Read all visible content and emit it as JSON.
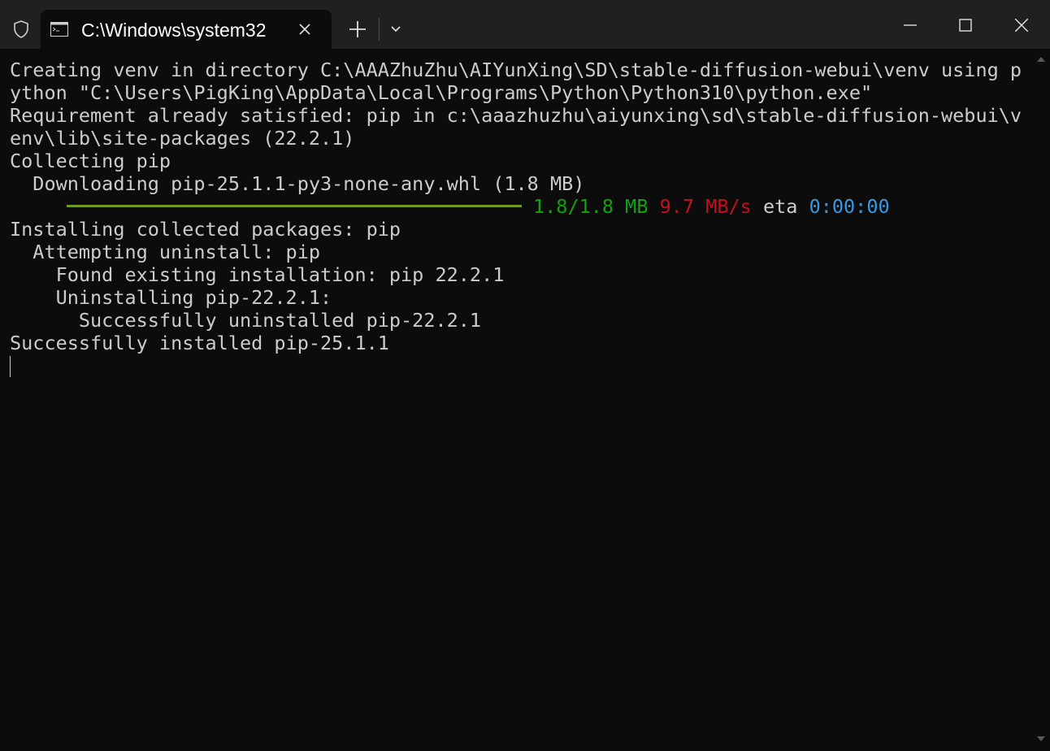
{
  "window": {
    "tab_title": "C:\\Windows\\system32",
    "icons": {
      "shield": "shield-icon",
      "tab": "console-icon",
      "close_tab": "close-icon",
      "new_tab": "plus-icon",
      "dropdown": "chevron-down-icon",
      "minimize": "minimize-icon",
      "maximize": "maximize-icon",
      "close": "close-icon"
    }
  },
  "terminal": {
    "lines": [
      "Creating venv in directory C:\\AAAZhuZhu\\AIYunXing\\SD\\stable-diffusion-webui\\venv using p",
      "ython \"C:\\Users\\PigKing\\AppData\\Local\\Programs\\Python\\Python310\\python.exe\"",
      "Requirement already satisfied: pip in c:\\aaazhuzhu\\aiyunxing\\sd\\stable-diffusion-webui\\v",
      "env\\lib\\site-packages (22.2.1)",
      "Collecting pip",
      "  Downloading pip-25.1.1-py3-none-any.whl (1.8 MB)"
    ],
    "progress": {
      "fraction": 1.0,
      "size": "1.8/1.8 MB",
      "speed": "9.7 MB/s",
      "eta_label": "eta",
      "eta": "0:00:00"
    },
    "lines_after": [
      "Installing collected packages: pip",
      "  Attempting uninstall: pip",
      "    Found existing installation: pip 22.2.1",
      "    Uninstalling pip-22.2.1:",
      "      Successfully uninstalled pip-22.2.1",
      "Successfully installed pip-25.1.1"
    ]
  },
  "colors": {
    "background": "#0c0c0c",
    "titlebar": "#202020",
    "text": "#cccccc",
    "progress_bar": "#6e9a1e",
    "size_green": "#13a10e",
    "speed_red": "#c50f1f",
    "eta_blue": "#3a96dd"
  }
}
